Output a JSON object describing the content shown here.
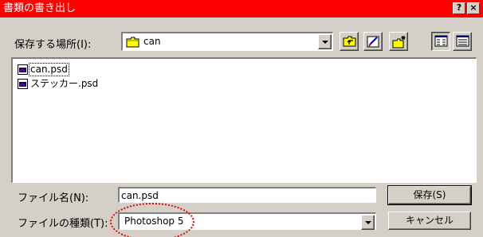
{
  "window": {
    "title": "書類の書き出し",
    "help_glyph": "?",
    "close_glyph": "×"
  },
  "save_in": {
    "label": "保存する場所(I):",
    "value": "can"
  },
  "files": [
    {
      "name": "can.psd",
      "selected": true
    },
    {
      "name": "ステッカー.psd",
      "selected": false
    }
  ],
  "file_name": {
    "label": "ファイル名(N):",
    "value": "can.psd"
  },
  "file_type": {
    "label": "ファイルの種類(T):",
    "value": "Photoshop 5"
  },
  "buttons": {
    "save": "保存(S)",
    "cancel": "キャンセル"
  },
  "colors": {
    "titlebar": "#ff0000",
    "annotation": "#e00000",
    "dialog": "#d4d0c8"
  }
}
